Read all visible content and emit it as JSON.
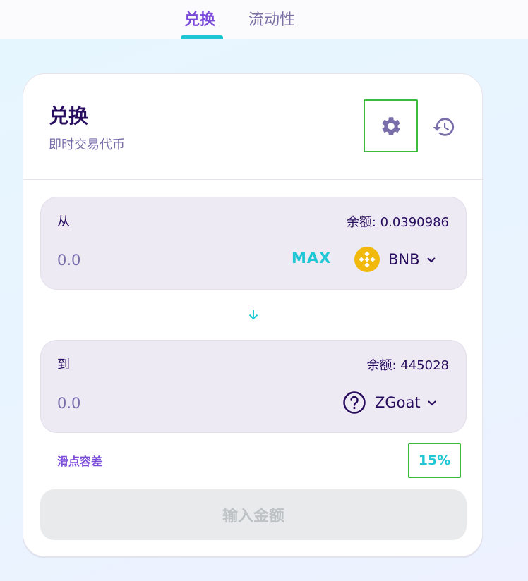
{
  "nav": {
    "tabs": [
      {
        "label": "兑换",
        "active": true
      },
      {
        "label": "流动性",
        "active": false
      }
    ]
  },
  "card": {
    "title": "兑换",
    "subtitle": "即时交易代币",
    "settings_icon": "gear-icon",
    "history_icon": "history-icon"
  },
  "from": {
    "label": "从",
    "balance_label": "余额:",
    "balance_value": "0.0390986",
    "amount_placeholder": "0.0",
    "max_label": "MAX",
    "token": "BNB",
    "token_icon": "bnb-logo-icon"
  },
  "to": {
    "label": "到",
    "balance_label": "余额:",
    "balance_value": "445028",
    "amount_placeholder": "0.0",
    "token": "ZGoat",
    "token_icon": "unknown-token-icon"
  },
  "slippage": {
    "label": "滑点容差",
    "value": "15%"
  },
  "submit": {
    "label": "输入金额"
  },
  "colors": {
    "primary_purple": "#7a4ad9",
    "accent_cyan": "#1fc7d4",
    "text_dark": "#280d5f",
    "text_muted": "#7a6eaa",
    "bnb_yellow": "#f0b90b",
    "highlight_green": "#3dbb3d"
  }
}
